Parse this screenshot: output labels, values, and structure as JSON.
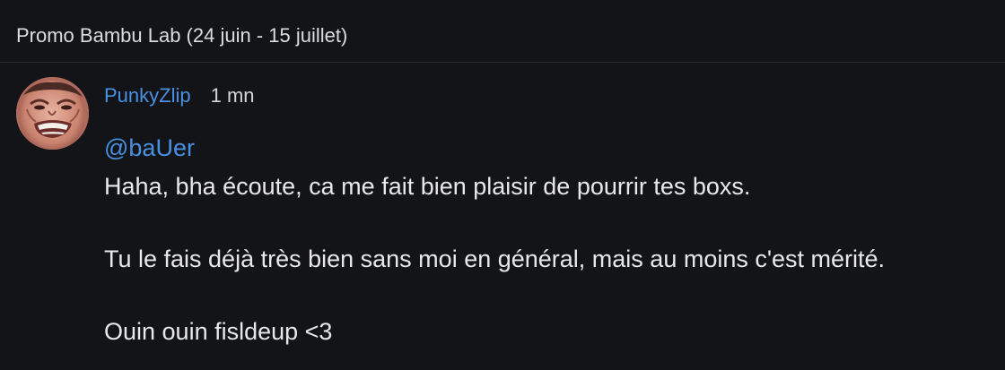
{
  "topic": {
    "title": "Promo Bambu Lab (24 juin - 15 juillet)"
  },
  "post": {
    "author": "PunkyZlip",
    "time": "1 mn",
    "avatar_icon": "grimacing-face-avatar",
    "mention": "@baUer",
    "paragraphs": [
      "Haha, bha écoute, ca me fait bien plaisir de pourrir tes boxs.",
      "Tu le fais déjà très bien sans moi en général, mais au moins c'est mérité.",
      "Ouin ouin fisldeup <3"
    ]
  },
  "colors": {
    "background": "#131417",
    "link": "#4a90e2",
    "text": "#e8e8e8",
    "divider": "#2a2b2f"
  }
}
